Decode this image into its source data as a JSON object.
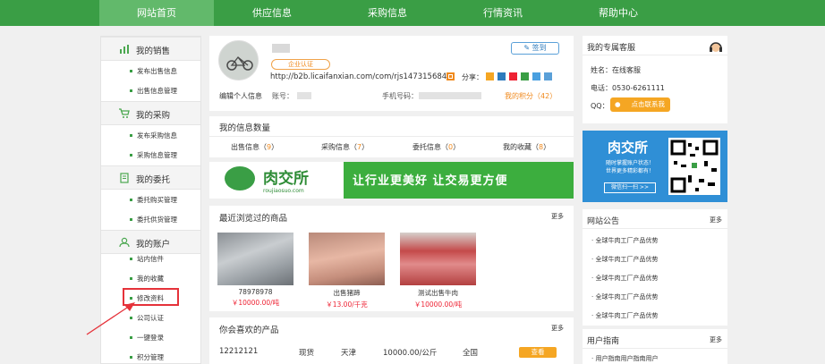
{
  "nav": {
    "items": [
      "网站首页",
      "供应信息",
      "采购信息",
      "行情资讯",
      "帮助中心"
    ]
  },
  "sidebar": {
    "sections": [
      {
        "title": "我的销售",
        "items": [
          "发布出售信息",
          "出售信息管理"
        ]
      },
      {
        "title": "我的采购",
        "items": [
          "发布采购信息",
          "采购信息管理"
        ]
      },
      {
        "title": "我的委托",
        "items": [
          "委托购买管理",
          "委托供货管理"
        ]
      },
      {
        "title": "我的账户",
        "items": [
          "站内信件",
          "我的收藏",
          "修改资料",
          "公司认证",
          "一键登录",
          "积分管理"
        ]
      }
    ]
  },
  "profile": {
    "badge": "企业认证",
    "url": "http://b2b.licaifanxian.com/com/rjs1473156843/",
    "share_label": "分享：",
    "signin": "签到",
    "edit_label": "编辑个人信息",
    "account_label": "账号：",
    "phone_label": "手机号码：",
    "points_label": "我的积分（",
    "points_value": "42",
    "points_close": "）"
  },
  "info": {
    "title": "我的信息数量",
    "stats": [
      {
        "label": "出售信息（",
        "count": "9",
        "close": "）"
      },
      {
        "label": "采购信息（",
        "count": "7",
        "close": "）"
      },
      {
        "label": "委托信息（",
        "count": "0",
        "close": "）"
      },
      {
        "label": "我的收藏（",
        "count": "8",
        "close": "）"
      }
    ]
  },
  "banner": {
    "logo": "肉交所",
    "logo_sub": "roujiaosuo.com",
    "slogan": "让行业更美好    让交易更方便"
  },
  "recent": {
    "title": "最近浏览过的商品",
    "more": "更多",
    "products": [
      {
        "name": "78978978",
        "price": "￥10000.00/吨"
      },
      {
        "name": "出售猪蹄",
        "price": "￥13.00/千克"
      },
      {
        "name": "测试出售牛肉",
        "price": "￥10000.00/吨"
      }
    ]
  },
  "like": {
    "title": "你会喜欢的产品",
    "more": "更多",
    "row": {
      "name": "12212121",
      "type": "现货",
      "city": "天津",
      "price": "10000.00/公斤",
      "area": "全国",
      "action": "查看"
    }
  },
  "service": {
    "title": "我的专属客服",
    "name": "姓名：在线客服",
    "phone": "电话：0530-6261111",
    "qq_label": "QQ：",
    "qq_button": "点击联系我"
  },
  "ad": {
    "brand": "肉交所",
    "sub1": "随时掌握账户状态！",
    "sub2": "世界更多精彩都有！",
    "scan": "微信扫一扫 >>"
  },
  "notice": {
    "title": "网站公告",
    "more": "更多",
    "items": [
      "全球牛肉工厂产品优势",
      "全球牛肉工厂产品优势",
      "全球牛肉工厂产品优势",
      "全球牛肉工厂产品优势",
      "全球牛肉工厂产品优势"
    ]
  },
  "guide": {
    "title": "用户指南",
    "more": "更多",
    "items": [
      "用户指南用户指南用户"
    ]
  },
  "colors": {
    "brand_green": "#3a9e45",
    "accent_orange": "#f5a623",
    "highlight_red": "#e5323a"
  }
}
